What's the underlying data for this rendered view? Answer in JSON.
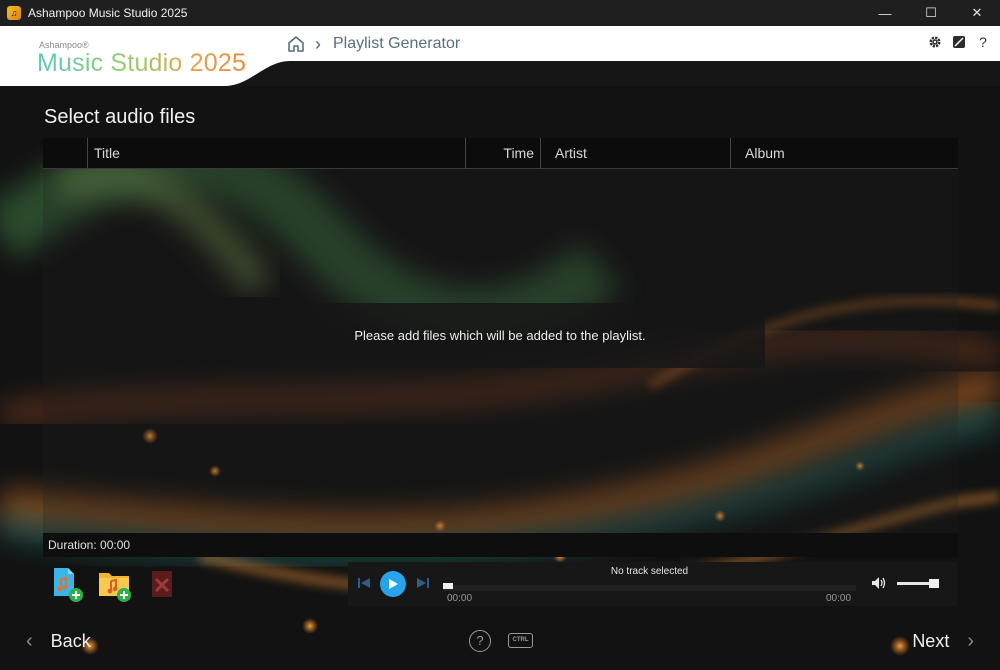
{
  "window": {
    "title": "Ashampoo Music Studio 2025",
    "minimize": "—",
    "maximize": "☐",
    "close": "✕"
  },
  "header": {
    "brand_small": "Ashampoo®",
    "brand_big": "Music Studio 2025",
    "breadcrumb_sep": "›",
    "breadcrumb_current": "Playlist Generator",
    "icons": [
      "gear-icon",
      "skin-icon",
      "help-icon"
    ],
    "help_glyph": "?"
  },
  "main": {
    "title": "Select audio files",
    "columns": [
      "",
      "Title",
      "Time",
      "Artist",
      "Album"
    ],
    "empty_message": "Please add files which will be added to the playlist.",
    "duration": "Duration: 00:00"
  },
  "player": {
    "track": "No track selected",
    "time_elapsed": "00:00",
    "time_total": "00:00",
    "progress": 0,
    "volume": 0.85
  },
  "footer": {
    "back_label": "Back",
    "next_label": "Next",
    "back_glyph": "‹",
    "next_glyph": "›",
    "help_glyph": "?",
    "ctrl_label": "CTRL"
  },
  "colors": {
    "accent": "#27a4ea",
    "add_badge": "#2bb34a",
    "delete_red": "#b02a2a"
  }
}
